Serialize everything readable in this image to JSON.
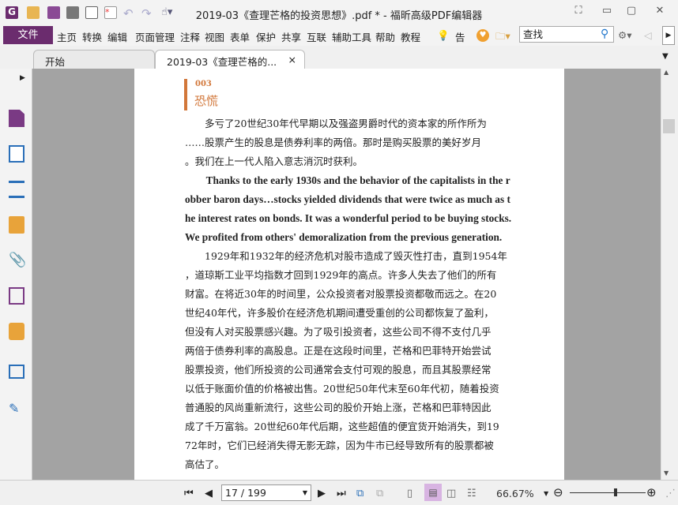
{
  "window": {
    "title": "2019-03《查理芒格的投资思想》.pdf * - 福昕高级PDF编辑器"
  },
  "menu": {
    "file": "文件",
    "items": [
      "主页",
      "转换",
      "编辑",
      "页面管理",
      "注释",
      "视图",
      "表单",
      "保护",
      "共享",
      "互联",
      "辅助工具",
      "帮助",
      "教程"
    ],
    "tell": "告诉",
    "search_placeholder": "查找"
  },
  "tabs": [
    {
      "label": "开始"
    },
    {
      "label": "2019-03《查理芒格的...",
      "close": "×"
    }
  ],
  "document": {
    "section_number": "003",
    "section_title": "恐慌",
    "lines_cn1": [
      "　　多亏了20世纪30年代早期以及强盗男爵时代的资本家的所作所为",
      "……股票产生的股息是债券利率的两倍。那时是购买股票的美好岁月",
      "。我们在上一代人陷入意志消沉时获利。"
    ],
    "lines_en": [
      "　　Thanks to the early 1930s and the behavior of the capitalists in the r",
      "obber baron days…stocks yielded dividends that were twice as much as t",
      "he interest rates on bonds. It was a wonderful period to be buying stocks.",
      "We profited from others' demoralization from the previous generation."
    ],
    "lines_cn2": [
      "　　1929年和1932年的经济危机对股市造成了毁灭性打击，直到1954年",
      "，道琼斯工业平均指数才回到1929年的高点。许多人失去了他们的所有",
      "财富。在将近30年的时间里，公众投资者对股票投资都敬而远之。在20",
      "世纪40年代，许多股价在经济危机期间遭受重创的公司都恢复了盈利，",
      "但没有人对买股票感兴趣。为了吸引投资者，这些公司不得不支付几乎",
      "两倍于债券利率的高股息。正是在这段时间里，芒格和巴菲特开始尝试",
      "股票投资，他们所投资的公司通常会支付可观的股息，而且其股票经常",
      "以低于账面价值的价格被出售。20世纪50年代末至60年代初，随着投资",
      "普通股的风尚重新流行，这些公司的股价开始上涨，芒格和巴菲特因此",
      "成了千万富翁。20世纪60年代后期，这些超值的便宜货开始消失，到19",
      "72年时，它们已经消失得无影无踪，因为牛市已经导致所有的股票都被",
      "高估了。"
    ]
  },
  "status": {
    "page": "17 / 199",
    "zoom": "66.67%",
    "zoom_fraction": 0.6
  },
  "colors": {
    "accent": "#6b2c6e",
    "heading": "#d2773a"
  }
}
